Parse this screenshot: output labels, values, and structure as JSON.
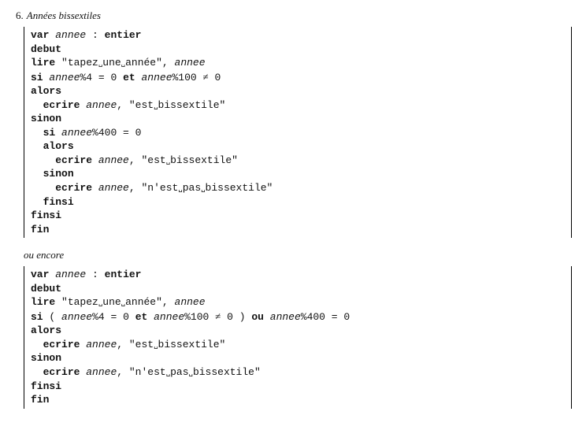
{
  "heading_num": "6.",
  "heading_title": "Années bissextiles",
  "ou_encore": "ou encore",
  "kw": {
    "var": "var",
    "entier": "entier",
    "debut": "debut",
    "lire": "lire",
    "si": "si",
    "et": "et",
    "ou": "ou",
    "alors": "alors",
    "ecrire": "ecrire",
    "sinon": "sinon",
    "finsi": "finsi",
    "fin": "fin"
  },
  "var": {
    "annee": "annee"
  },
  "str": {
    "prompt": "\"tapez␣une␣année\"",
    "bissextile": "\"est␣bissextile\"",
    "non_bissextile": "\"n'est␣pas␣bissextile\""
  },
  "op": {
    "colon": ":",
    "comma": ",",
    "mod4eq0": "%4 = 0",
    "mod100": "%100",
    "mod400eq0": "%400 = 0",
    "neq0": " 0",
    "lparen": "(",
    "rparen": ")"
  }
}
